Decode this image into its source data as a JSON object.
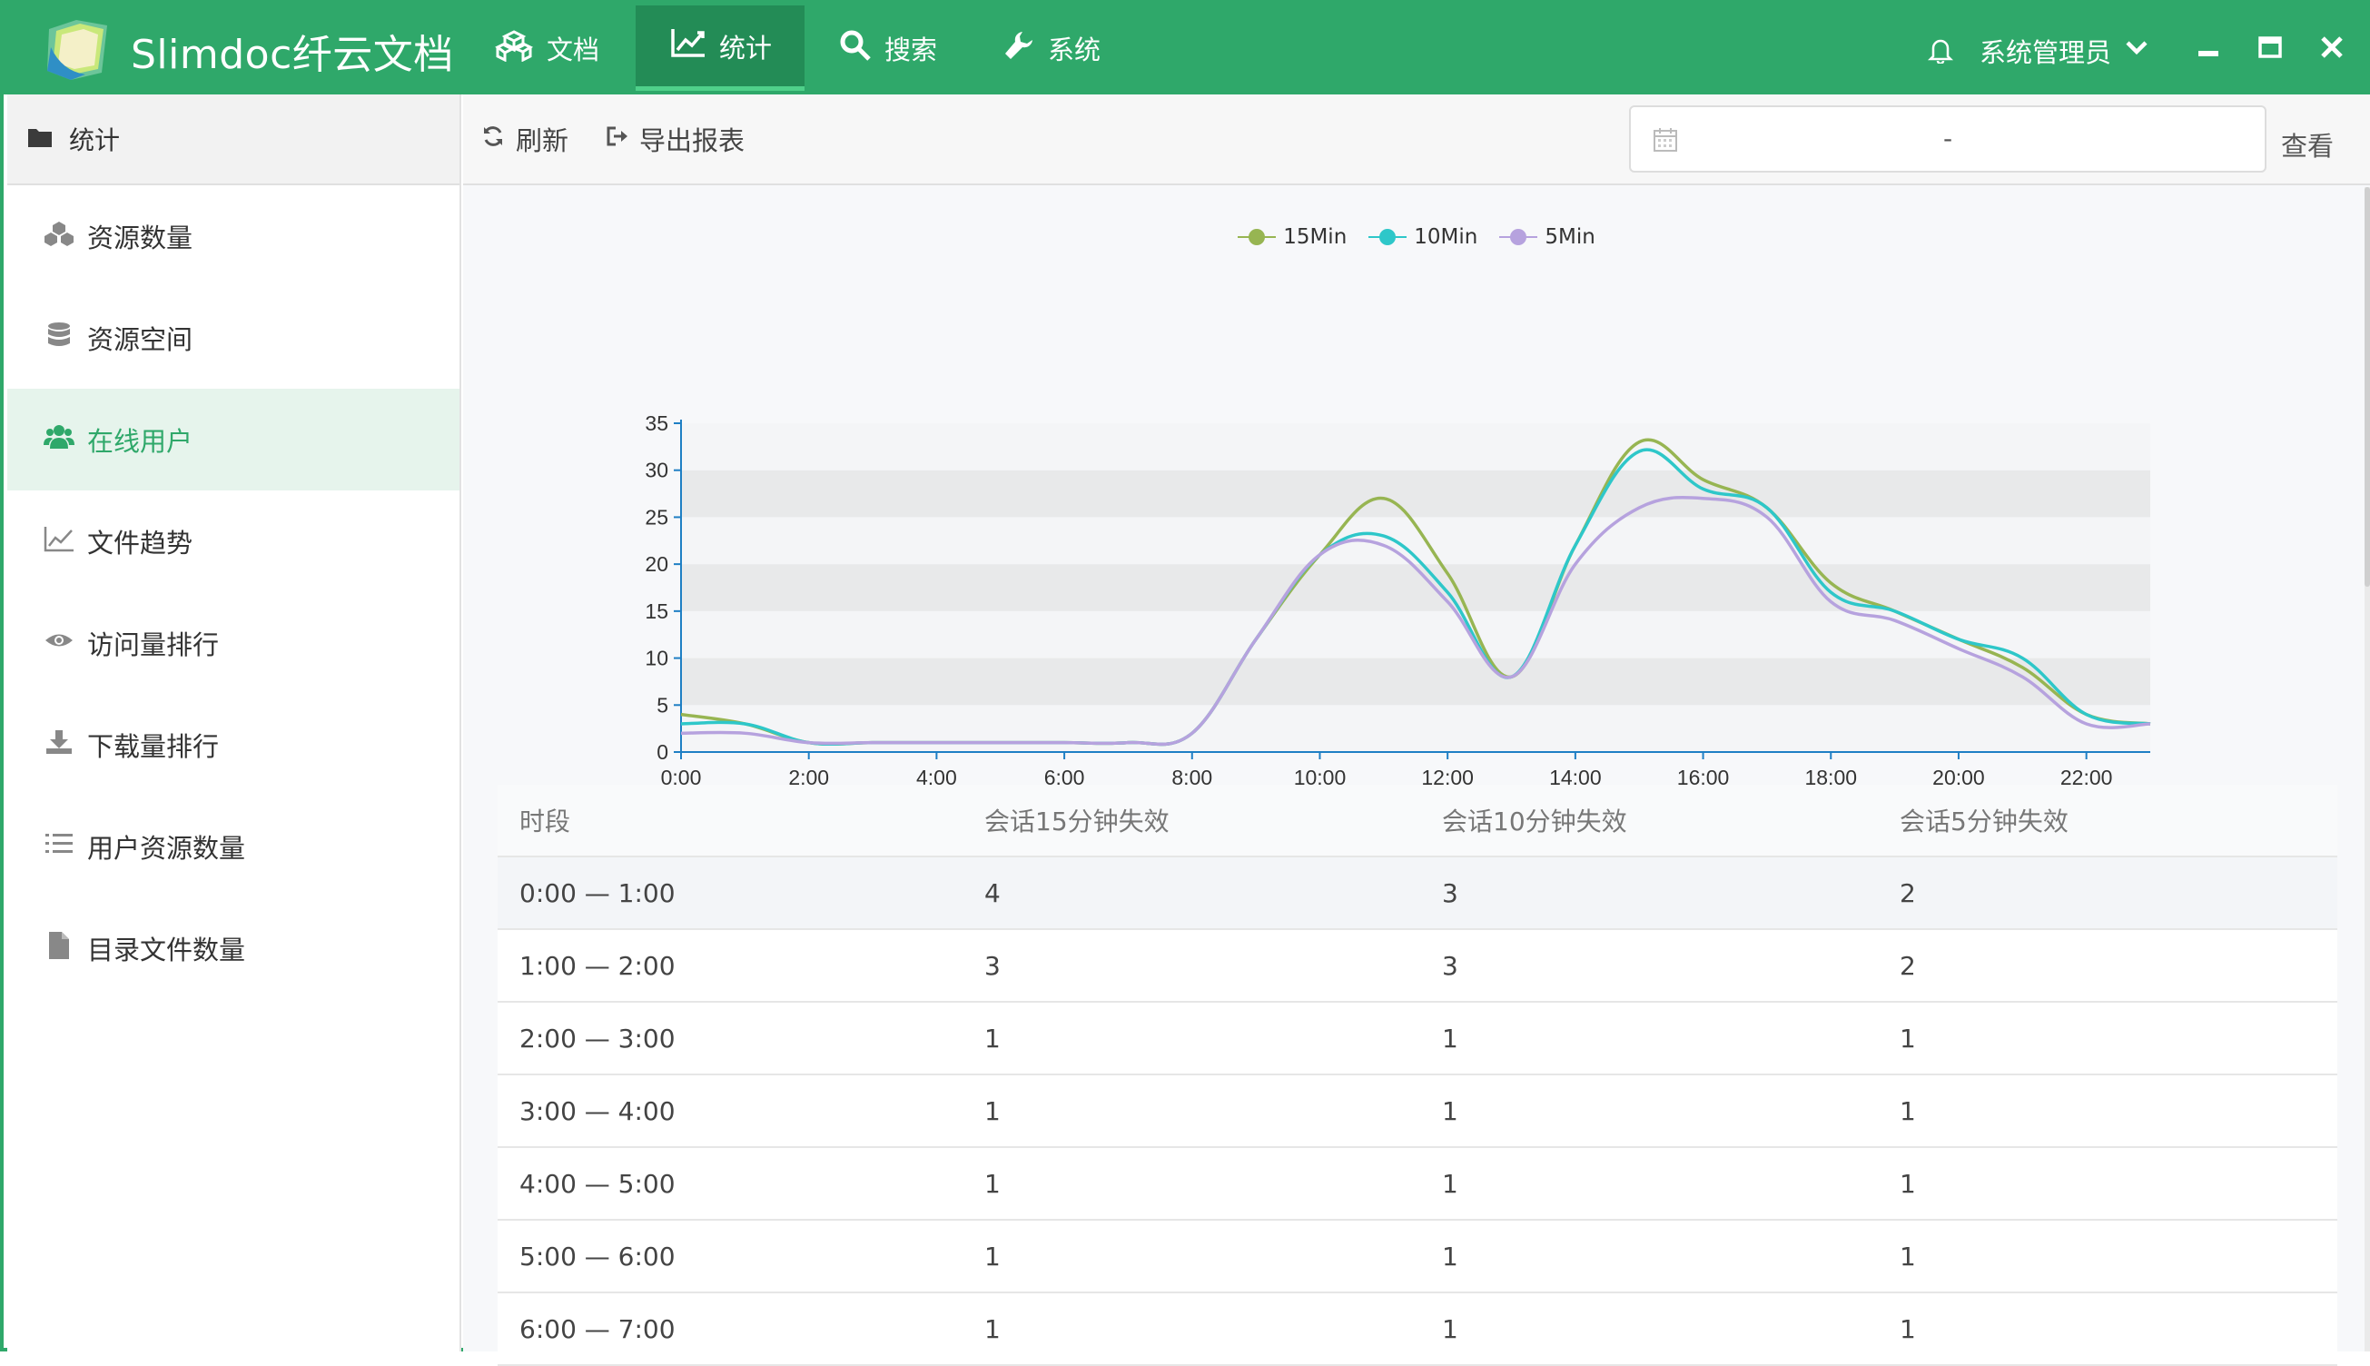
{
  "app": {
    "title": "Slimdoc纤云文档"
  },
  "nav": [
    {
      "label": "文档",
      "icon": "cubes-icon"
    },
    {
      "label": "统计",
      "icon": "line-chart-icon",
      "active": true
    },
    {
      "label": "搜索",
      "icon": "search-icon"
    },
    {
      "label": "系统",
      "icon": "wrench-icon"
    }
  ],
  "user": {
    "name": "系统管理员"
  },
  "sidebar": {
    "header": "统计",
    "items": [
      {
        "label": "资源数量",
        "icon": "cubes-icon"
      },
      {
        "label": "资源空间",
        "icon": "database-icon"
      },
      {
        "label": "在线用户",
        "icon": "users-icon",
        "active": true
      },
      {
        "label": "文件趋势",
        "icon": "area-chart-icon"
      },
      {
        "label": "访问量排行",
        "icon": "eye-icon"
      },
      {
        "label": "下载量排行",
        "icon": "download-icon"
      },
      {
        "label": "用户资源数量",
        "icon": "list-icon"
      },
      {
        "label": "目录文件数量",
        "icon": "file-icon"
      }
    ]
  },
  "toolbar": {
    "refresh": "刷新",
    "export": "导出报表",
    "date_sep": "-",
    "view": "查看"
  },
  "chart_data": {
    "type": "line",
    "x": [
      "0:00",
      "1:00",
      "2:00",
      "3:00",
      "4:00",
      "5:00",
      "6:00",
      "7:00",
      "8:00",
      "9:00",
      "10:00",
      "11:00",
      "12:00",
      "13:00",
      "14:00",
      "15:00",
      "16:00",
      "17:00",
      "18:00",
      "19:00",
      "20:00",
      "21:00",
      "22:00",
      "23:00"
    ],
    "x_tick_labels": [
      "0:00",
      "2:00",
      "4:00",
      "6:00",
      "8:00",
      "10:00",
      "12:00",
      "14:00",
      "16:00",
      "18:00",
      "20:00",
      "22:00"
    ],
    "y_tick_labels": [
      "0",
      "5",
      "10",
      "15",
      "20",
      "25",
      "30",
      "35"
    ],
    "ylim": [
      0,
      35
    ],
    "series": [
      {
        "name": "15Min",
        "color": "#97b552",
        "values": [
          4,
          3,
          1,
          1,
          1,
          1,
          1,
          1,
          2,
          12,
          21,
          27,
          19,
          8,
          22,
          33,
          29,
          26,
          18,
          15,
          12,
          9,
          4,
          3
        ]
      },
      {
        "name": "10Min",
        "color": "#2ec7c9",
        "values": [
          3,
          3,
          1,
          1,
          1,
          1,
          1,
          1,
          2,
          12,
          21,
          23,
          17,
          8,
          22,
          32,
          28,
          26,
          17,
          15,
          12,
          10,
          4,
          3
        ]
      },
      {
        "name": "5Min",
        "color": "#b6a2de",
        "values": [
          2,
          2,
          1,
          1,
          1,
          1,
          1,
          1,
          2,
          12,
          21,
          22,
          16,
          8,
          20,
          26,
          27,
          25,
          16,
          14,
          11,
          8,
          3,
          3
        ]
      }
    ],
    "legend": "top-center",
    "grid": true
  },
  "table": {
    "headers": [
      "时段",
      "会话15分钟失效",
      "会话10分钟失效",
      "会话5分钟失效"
    ],
    "rows": [
      [
        "0:00 — 1:00",
        "4",
        "3",
        "2"
      ],
      [
        "1:00 — 2:00",
        "3",
        "3",
        "2"
      ],
      [
        "2:00 — 3:00",
        "1",
        "1",
        "1"
      ],
      [
        "3:00 — 4:00",
        "1",
        "1",
        "1"
      ],
      [
        "4:00 — 5:00",
        "1",
        "1",
        "1"
      ],
      [
        "5:00 — 6:00",
        "1",
        "1",
        "1"
      ],
      [
        "6:00 — 7:00",
        "1",
        "1",
        "1"
      ]
    ]
  }
}
